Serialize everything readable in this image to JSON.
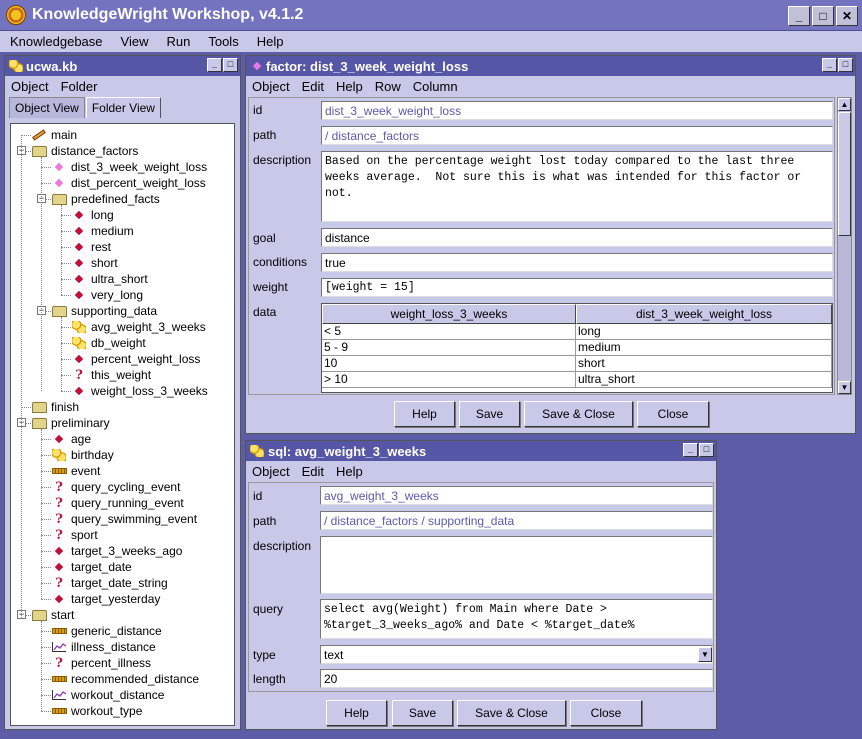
{
  "app": {
    "title": "KnowledgeWright Workshop, v4.1.2",
    "menu": [
      "Knowledgebase",
      "View",
      "Run",
      "Tools",
      "Help"
    ]
  },
  "kb_window": {
    "title": "ucwa.kb",
    "menu": [
      "Object",
      "Folder"
    ],
    "tabs": [
      "Object View",
      "Folder View"
    ],
    "active_tab": "Folder View",
    "tree": [
      {
        "label": "main",
        "icon": "pencil-icon",
        "depth": 0
      },
      {
        "label": "distance_factors",
        "icon": "folder-icon",
        "depth": 0,
        "expanded": true
      },
      {
        "label": "dist_3_week_weight_loss",
        "icon": "factor-icon",
        "depth": 1
      },
      {
        "label": "dist_percent_weight_loss",
        "icon": "factor-icon",
        "depth": 1
      },
      {
        "label": "predefined_facts",
        "icon": "folder-icon",
        "depth": 1,
        "expanded": true
      },
      {
        "label": "long",
        "icon": "fact-icon",
        "depth": 2
      },
      {
        "label": "medium",
        "icon": "fact-icon",
        "depth": 2
      },
      {
        "label": "rest",
        "icon": "fact-icon",
        "depth": 2
      },
      {
        "label": "short",
        "icon": "fact-icon",
        "depth": 2
      },
      {
        "label": "ultra_short",
        "icon": "fact-icon",
        "depth": 2
      },
      {
        "label": "very_long",
        "icon": "fact-icon",
        "depth": 2
      },
      {
        "label": "supporting_data",
        "icon": "folder-icon",
        "depth": 1,
        "expanded": true
      },
      {
        "label": "avg_weight_3_weeks",
        "icon": "sql-icon",
        "depth": 2
      },
      {
        "label": "db_weight",
        "icon": "sql-icon",
        "depth": 2
      },
      {
        "label": "percent_weight_loss",
        "icon": "fact-icon",
        "depth": 2
      },
      {
        "label": "this_weight",
        "icon": "question-icon",
        "depth": 2
      },
      {
        "label": "weight_loss_3_weeks",
        "icon": "fact-icon",
        "depth": 2
      },
      {
        "label": "finish",
        "icon": "folder-icon",
        "depth": 0
      },
      {
        "label": "preliminary",
        "icon": "folder-icon",
        "depth": 0,
        "expanded": true
      },
      {
        "label": "age",
        "icon": "fact-icon",
        "depth": 1
      },
      {
        "label": "birthday",
        "icon": "sql-icon",
        "depth": 1
      },
      {
        "label": "event",
        "icon": "ruler-icon",
        "depth": 1
      },
      {
        "label": "query_cycling_event",
        "icon": "question-icon",
        "depth": 1
      },
      {
        "label": "query_running_event",
        "icon": "question-icon",
        "depth": 1
      },
      {
        "label": "query_swimming_event",
        "icon": "question-icon",
        "depth": 1
      },
      {
        "label": "sport",
        "icon": "question-icon",
        "depth": 1
      },
      {
        "label": "target_3_weeks_ago",
        "icon": "fact-icon",
        "depth": 1
      },
      {
        "label": "target_date",
        "icon": "fact-icon",
        "depth": 1
      },
      {
        "label": "target_date_string",
        "icon": "question-icon",
        "depth": 1
      },
      {
        "label": "target_yesterday",
        "icon": "fact-icon",
        "depth": 1
      },
      {
        "label": "start",
        "icon": "folder-icon",
        "depth": 0,
        "expanded": true
      },
      {
        "label": "generic_distance",
        "icon": "ruler-icon",
        "depth": 1
      },
      {
        "label": "illness_distance",
        "icon": "chart-icon",
        "depth": 1
      },
      {
        "label": "percent_illness",
        "icon": "question-icon",
        "depth": 1
      },
      {
        "label": "recommended_distance",
        "icon": "ruler-icon",
        "depth": 1
      },
      {
        "label": "workout_distance",
        "icon": "chart-icon",
        "depth": 1
      },
      {
        "label": "workout_type",
        "icon": "ruler-icon",
        "depth": 1
      }
    ]
  },
  "factor_window": {
    "title": "factor: dist_3_week_weight_loss",
    "menu": [
      "Object",
      "Edit",
      "Help",
      "Row",
      "Column"
    ],
    "labels": {
      "id": "id",
      "path": "path",
      "description": "description",
      "goal": "goal",
      "conditions": "conditions",
      "weight": "weight",
      "data": "data"
    },
    "id": "dist_3_week_weight_loss",
    "path": "/ distance_factors",
    "description": "Based on the percentage weight lost today compared to the last three\nweeks average.  Not sure this is what was intended for this factor or\nnot.",
    "goal": "distance",
    "conditions": "true",
    "weight": "[weight = 15]",
    "table": {
      "columns": [
        "weight_loss_3_weeks",
        "dist_3_week_weight_loss"
      ],
      "rows": [
        [
          "< 5",
          "long"
        ],
        [
          "5 - 9",
          "medium"
        ],
        [
          "10",
          "short"
        ],
        [
          "> 10",
          "ultra_short"
        ]
      ]
    },
    "buttons": [
      "Help",
      "Save",
      "Save & Close",
      "Close"
    ]
  },
  "sql_window": {
    "title": "sql: avg_weight_3_weeks",
    "menu": [
      "Object",
      "Edit",
      "Help"
    ],
    "labels": {
      "id": "id",
      "path": "path",
      "description": "description",
      "query": "query",
      "type": "type",
      "length": "length"
    },
    "id": "avg_weight_3_weeks",
    "path": "/ distance_factors / supporting_data",
    "description": "",
    "query": "select avg(Weight) from Main where Date >\n%target_3_weeks_ago% and Date < %target_date%",
    "type": "text",
    "length": "20",
    "buttons": [
      "Help",
      "Save",
      "Save & Close",
      "Close"
    ]
  },
  "colors": {
    "desktop": "#5d5da7",
    "titlebar": "#7373bf",
    "subtitle": "#5656a6",
    "panel": "#c8c8e8"
  }
}
